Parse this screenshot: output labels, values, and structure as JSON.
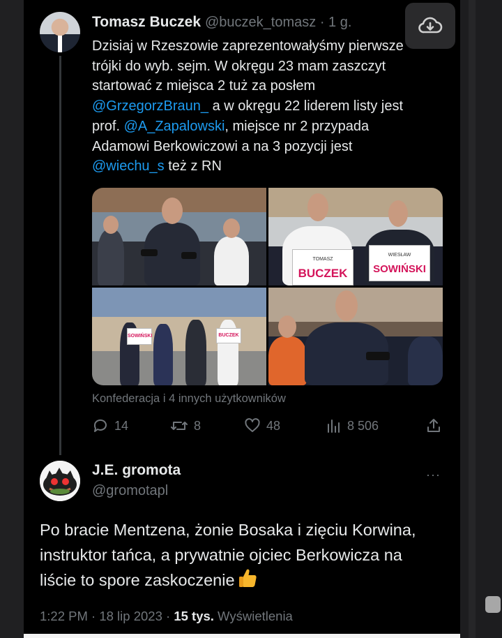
{
  "tweet": {
    "author_name": "Tomasz Buczek",
    "author_handle": "@buczek_tomasz",
    "time": "· 1 g.",
    "text_lines": [
      "Dzisiaj w Rzeszowie zaprezentowałyśmy pierwsze",
      "trójki do wyb. sejm. W okręgu 23 mam zaszczyt",
      "startować z miejsca 2 tuż za posłem"
    ],
    "mention_1": "@GrzegorzBraun_",
    "line_4_rest": " a w okręgu 22 liderem listy jest",
    "line_5_pre": "prof. ",
    "mention_2": "@A_Zapalowski",
    "line_5_rest": ", miejsce nr 2 przypada",
    "line_6": "Adamowi Berkowiczowi a na 3 pozycji jest",
    "mention_3": "@wiechu_s",
    "line_7_rest": " też z RN",
    "media_credit": "Konfederacja i 4 innych użytkowników",
    "signs": {
      "buczek_first": "TOMASZ",
      "buczek_last": "BUCZEK",
      "sowinski_first": "WIESŁAW",
      "sowinski_last": "SOWIŃSKI",
      "small_sowinski": "SOWIŃSKI",
      "small_buczek": "BUCZEK"
    },
    "stats": {
      "replies": "14",
      "retweets": "8",
      "likes": "48",
      "views": "8 506"
    }
  },
  "reply": {
    "author_name": "J.E. gromota",
    "author_handle": "@gromotapl",
    "text_lines": [
      "Po bracie Mentzena, żonie Bosaka i zięciu Korwina,",
      "instruktor tańca, a prywatnie ojciec Berkowicza na",
      "liście to spore zaskoczenie"
    ],
    "more_label": "···",
    "time": "1:22 PM · 18 lip 2023 · ",
    "views_count": "15 tys.",
    "views_label": " Wyświetlenia"
  },
  "icons": [
    "cloud-download-icon",
    "reply-icon",
    "retweet-icon",
    "like-icon",
    "views-icon",
    "share-icon",
    "more-icon",
    "thumbs-up-icon"
  ],
  "colors": {
    "background": "#000000",
    "text": "#e7e9ea",
    "muted": "#71767b",
    "link": "#1d9bf0"
  }
}
